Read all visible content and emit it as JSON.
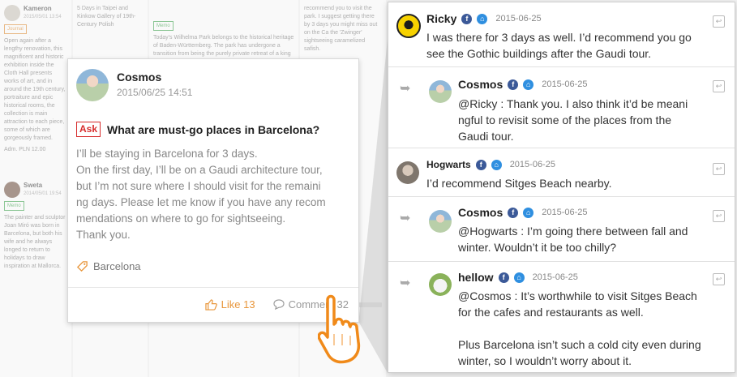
{
  "background_feed": {
    "col1_user": "Kameron",
    "col1_date": "2015/05/01 13:54",
    "col1_tag": "Journal",
    "col1_meta": "Adm.   PLN 12.00",
    "col1b_user": "Sweta",
    "col1b_date": "2014/05/01 19:54",
    "col1b_tag": "Memo",
    "col2_title": "5 Days in Taipei and Kinkow Gallery of 19th-Century Polish",
    "col3_tag": "Memo",
    "col3_text": "Today's Wilhelma Park belongs to the historical heritage of Baden-Württemberg. The park has undergone a transition from being the purely private retreat of a king to become",
    "col4_text": "recommend you to visit the park. I suggest getting there by 3 days you might miss out on the Ca the 'Zwinger' sightseeing caramelized safish.",
    "col1_text": "Open again after a lengthy renovation, this magnificent and historic exhibition inside the Cloth Hall presents works of art, and in around the 19th century, portraiture and epic historical rooms, the collection is main attraction to each piece, some of which are gorgeously framed.",
    "col1b_text": "The painter and sculptor Joan Miró was born in Barcelona, but both his wife and he always longed to return to holidays to draw inspiration at Mallorca."
  },
  "post": {
    "author": "Cosmos",
    "date": "2015/06/25 14:51",
    "badge": "Ask",
    "title": "What are must-go places in Barcelona?",
    "body": [
      "I’ll be staying in Barcelona for 3 days.",
      "On the first day, I’ll be on a Gaudi architecture tour,",
      "but I’m not sure where I should visit for the remaini",
      "ng days. Please let me know if you have any recom",
      "mendations on where to go for sightseeing.",
      "Thank you."
    ],
    "location": "Barcelona",
    "like_label": "Like 13",
    "comment_label": "Comment 32"
  },
  "comments": [
    {
      "author": "Ricky",
      "date": "2015-06-25",
      "text": [
        "I was there for 3 days as well. I’d recommend you go",
        "see the Gothic buildings after the Gaudi tour."
      ],
      "is_reply": false,
      "sns": [
        "facebook",
        "home"
      ]
    },
    {
      "author": "Cosmos",
      "date": "2015-06-25",
      "text": [
        "@Ricky : Thank you. I also think it’d be meani",
        "ngful to revisit some of the places from the",
        "Gaudi tour."
      ],
      "is_reply": true,
      "sns": [
        "facebook",
        "home"
      ]
    },
    {
      "author": "Hogwarts",
      "date": "2015-06-25",
      "text": [
        "I’d recommend Sitges Beach nearby."
      ],
      "is_reply": false,
      "sns": [
        "facebook",
        "home"
      ]
    },
    {
      "author": "Cosmos",
      "date": "2015-06-25",
      "text": [
        "@Hogwarts : I’m going there between fall and",
        "winter. Wouldn’t it be too chilly?"
      ],
      "is_reply": true,
      "sns": [
        "facebook",
        "home"
      ]
    },
    {
      "author": "hellow",
      "date": "2015-06-25",
      "text": [
        "@Cosmos : It’s worthwhile to visit Sitges Beach",
        "for the cafes and restaurants as well.",
        "",
        "Plus Barcelona isn’t such a cold city even during",
        "winter, so I wouldn’t worry about it."
      ],
      "is_reply": true,
      "sns": [
        "facebook",
        "home"
      ]
    }
  ],
  "icons": {
    "like": "thumbs-up-icon",
    "comment": "speech-bubble-icon",
    "location": "tag-icon",
    "reply_arrow": "reply-arrow-icon",
    "reply_button": "reply-icon",
    "pointer": "pointing-hand-icon",
    "facebook": "facebook-icon",
    "home": "home-icon"
  },
  "colors": {
    "accent_orange": "#e8963b",
    "ask_red": "#d62b2b",
    "facebook_blue": "#3b5998",
    "home_blue": "#2f8fe0"
  }
}
